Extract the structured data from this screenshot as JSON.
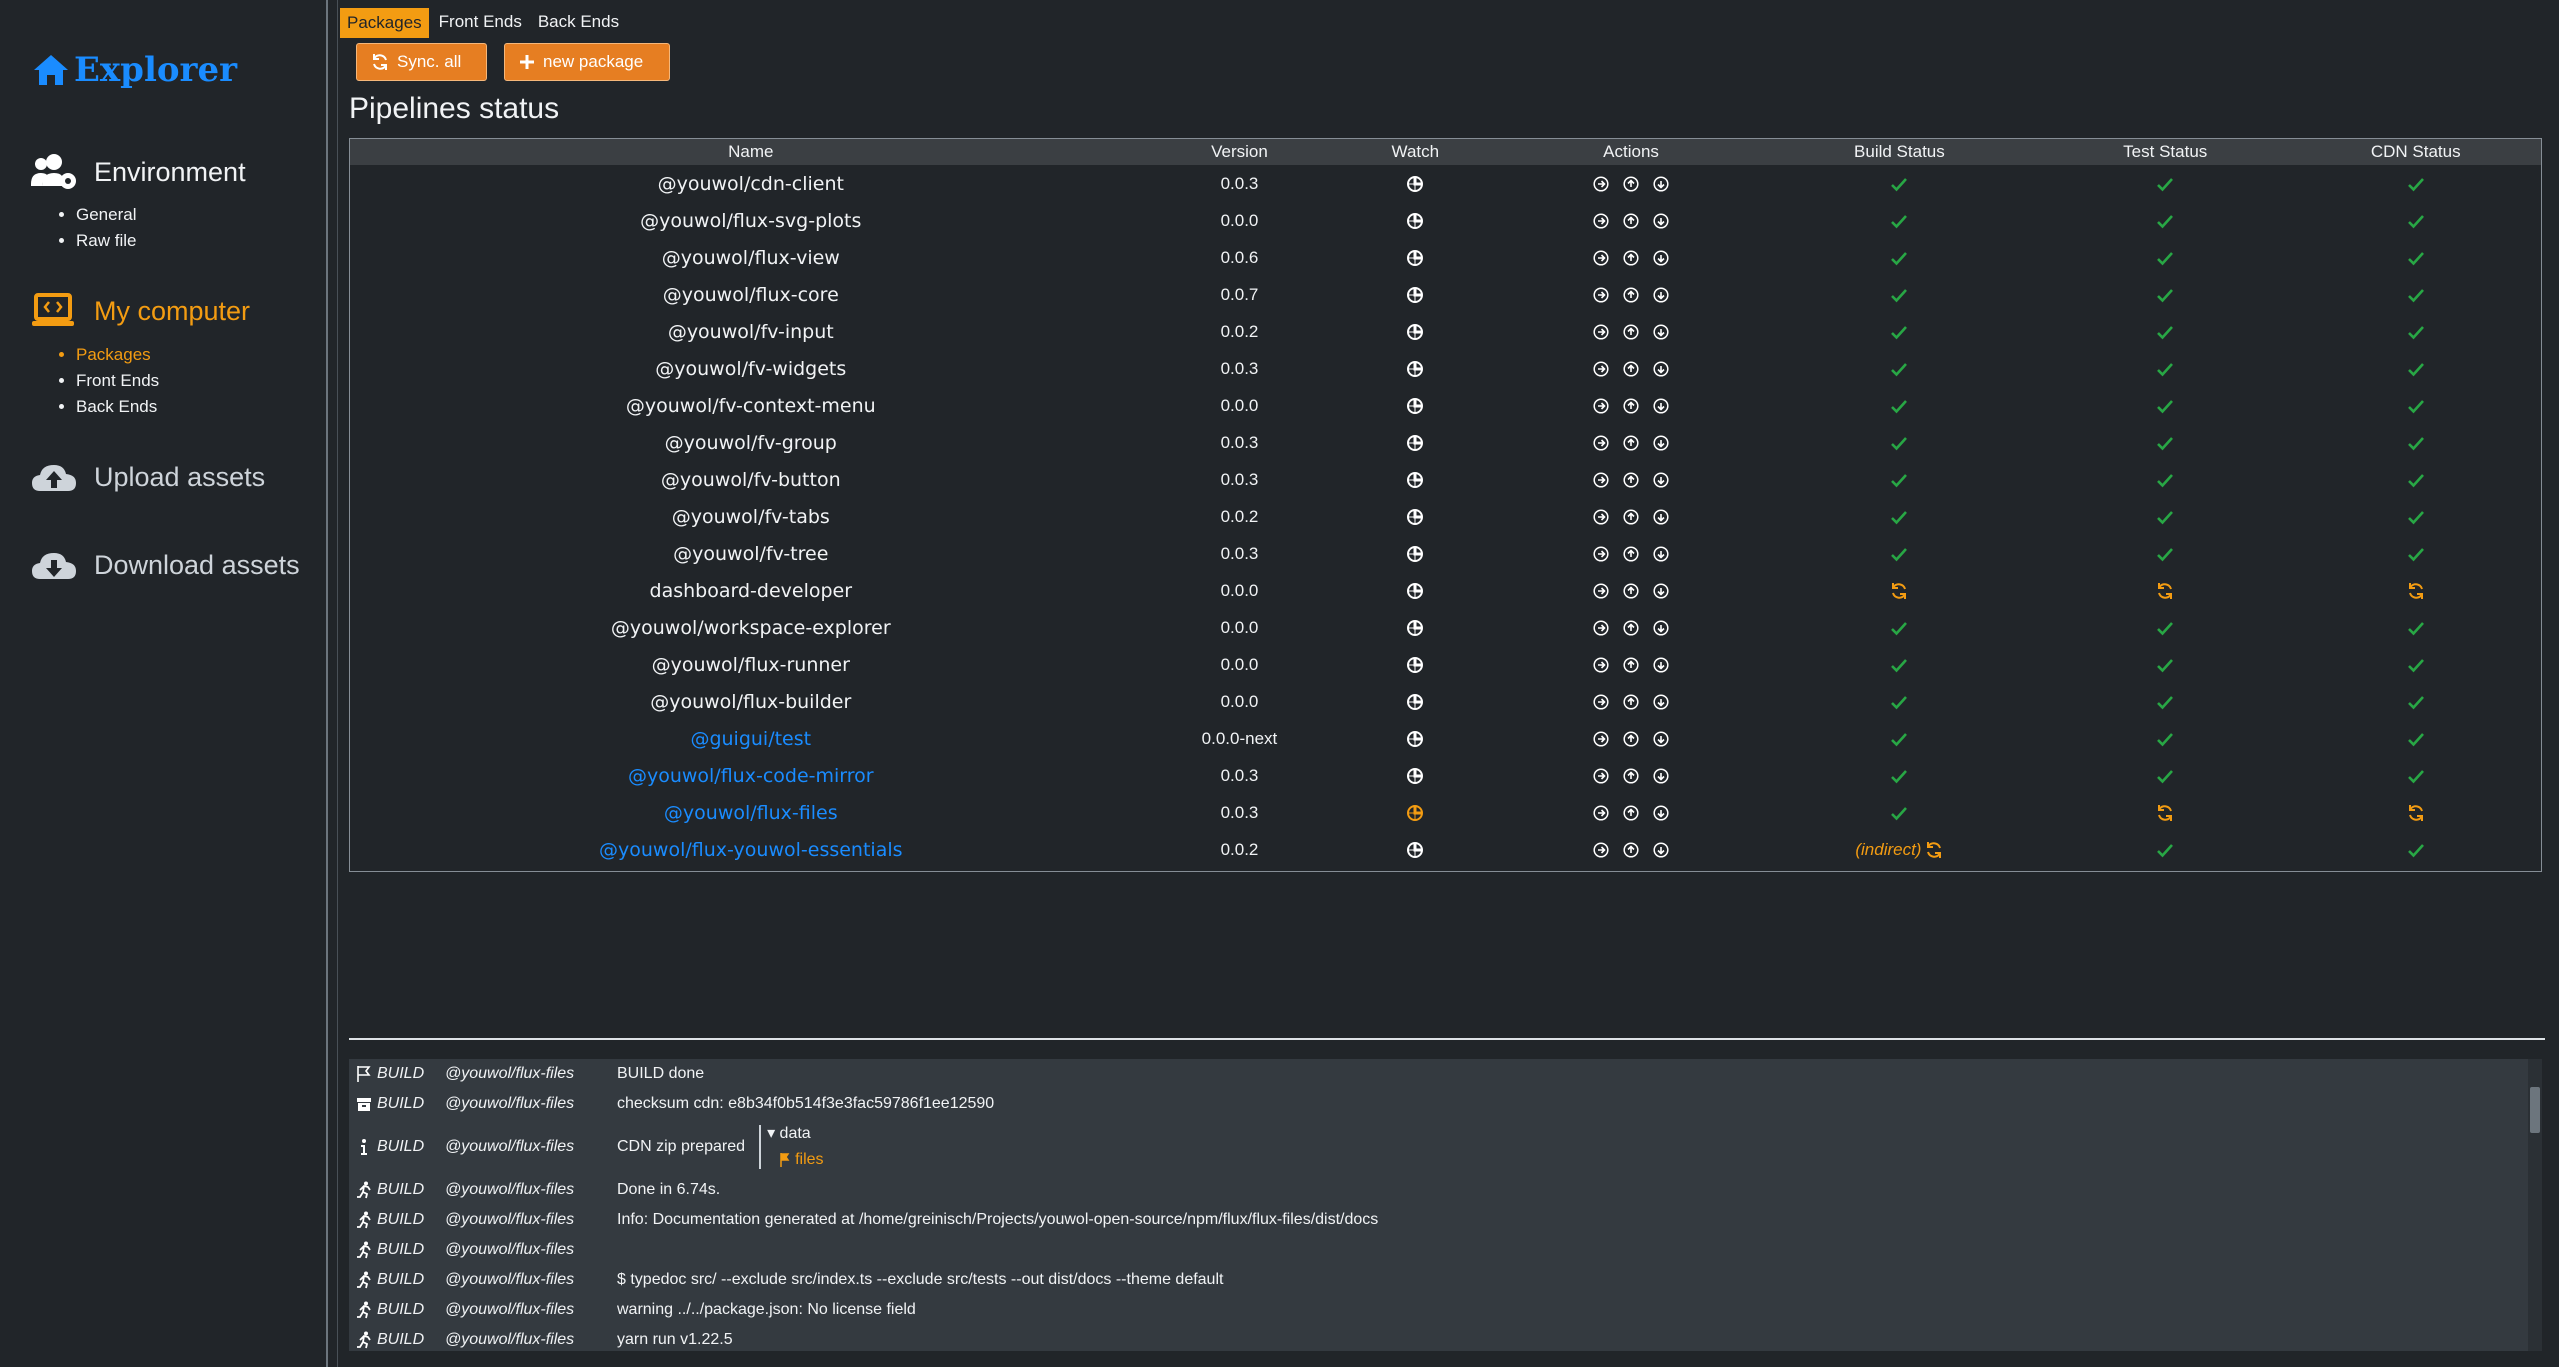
{
  "sidebar": {
    "brand": "Explorer",
    "sections": [
      {
        "title": "Environment",
        "icon": "users-cog-icon",
        "items": [
          "General",
          "Raw file"
        ]
      },
      {
        "title": "My computer",
        "icon": "laptop-code-icon",
        "items": [
          "Packages",
          "Front Ends",
          "Back Ends"
        ],
        "active": true,
        "active_item": "Packages"
      },
      {
        "title": "Upload assets",
        "icon": "cloud-upload-icon",
        "items": []
      },
      {
        "title": "Download assets",
        "icon": "cloud-download-icon",
        "items": []
      }
    ]
  },
  "tabs": [
    "Packages",
    "Front Ends",
    "Back Ends"
  ],
  "active_tab": "Packages",
  "buttons": {
    "sync": "Sync. all",
    "new_package": "new package"
  },
  "page_title": "Pipelines status",
  "table": {
    "headers": [
      "Name",
      "Version",
      "Watch",
      "Actions",
      "Build Status",
      "Test Status",
      "CDN Status"
    ],
    "rows": [
      {
        "name": "@youwol/cdn-client",
        "version": "0.0.3",
        "watch": "off",
        "build": "ok",
        "test": "ok",
        "cdn": "ok",
        "link": false
      },
      {
        "name": "@youwol/flux-svg-plots",
        "version": "0.0.0",
        "watch": "off",
        "build": "ok",
        "test": "ok",
        "cdn": "ok",
        "link": false
      },
      {
        "name": "@youwol/flux-view",
        "version": "0.0.6",
        "watch": "off",
        "build": "ok",
        "test": "ok",
        "cdn": "ok",
        "link": false
      },
      {
        "name": "@youwol/flux-core",
        "version": "0.0.7",
        "watch": "off",
        "build": "ok",
        "test": "ok",
        "cdn": "ok",
        "link": false
      },
      {
        "name": "@youwol/fv-input",
        "version": "0.0.2",
        "watch": "off",
        "build": "ok",
        "test": "ok",
        "cdn": "ok",
        "link": false
      },
      {
        "name": "@youwol/fv-widgets",
        "version": "0.0.3",
        "watch": "off",
        "build": "ok",
        "test": "ok",
        "cdn": "ok",
        "link": false
      },
      {
        "name": "@youwol/fv-context-menu",
        "version": "0.0.0",
        "watch": "off",
        "build": "ok",
        "test": "ok",
        "cdn": "ok",
        "link": false
      },
      {
        "name": "@youwol/fv-group",
        "version": "0.0.3",
        "watch": "off",
        "build": "ok",
        "test": "ok",
        "cdn": "ok",
        "link": false
      },
      {
        "name": "@youwol/fv-button",
        "version": "0.0.3",
        "watch": "off",
        "build": "ok",
        "test": "ok",
        "cdn": "ok",
        "link": false
      },
      {
        "name": "@youwol/fv-tabs",
        "version": "0.0.2",
        "watch": "off",
        "build": "ok",
        "test": "ok",
        "cdn": "ok",
        "link": false
      },
      {
        "name": "@youwol/fv-tree",
        "version": "0.0.3",
        "watch": "off",
        "build": "ok",
        "test": "ok",
        "cdn": "ok",
        "link": false
      },
      {
        "name": "dashboard-developer",
        "version": "0.0.0",
        "watch": "off",
        "build": "sync",
        "test": "sync",
        "cdn": "sync",
        "link": false
      },
      {
        "name": "@youwol/workspace-explorer",
        "version": "0.0.0",
        "watch": "off",
        "build": "ok",
        "test": "ok",
        "cdn": "ok",
        "link": false
      },
      {
        "name": "@youwol/flux-runner",
        "version": "0.0.0",
        "watch": "off",
        "build": "ok",
        "test": "ok",
        "cdn": "ok",
        "link": false
      },
      {
        "name": "@youwol/flux-builder",
        "version": "0.0.0",
        "watch": "off",
        "build": "ok",
        "test": "ok",
        "cdn": "ok",
        "link": false
      },
      {
        "name": "@guigui/test",
        "version": "0.0.0-next",
        "watch": "off",
        "build": "ok",
        "test": "ok",
        "cdn": "ok",
        "link": true
      },
      {
        "name": "@youwol/flux-code-mirror",
        "version": "0.0.3",
        "watch": "off",
        "build": "ok",
        "test": "ok",
        "cdn": "ok",
        "link": true
      },
      {
        "name": "@youwol/flux-files",
        "version": "0.0.3",
        "watch": "on",
        "build": "ok",
        "test": "sync",
        "cdn": "sync",
        "link": true
      },
      {
        "name": "@youwol/flux-youwol-essentials",
        "version": "0.0.2",
        "watch": "off",
        "build": "indirect",
        "test": "ok",
        "cdn": "ok",
        "link": true
      }
    ],
    "indirect_label": "(indirect)"
  },
  "log": {
    "rows": [
      {
        "icon": "flag-icon",
        "step": "BUILD",
        "pkg": "@youwol/flux-files",
        "msg": "BUILD done"
      },
      {
        "icon": "archive-icon",
        "step": "BUILD",
        "pkg": "@youwol/flux-files",
        "msg": "checksum cdn: e8b34f0b514f3e3fac59786f1ee12590"
      },
      {
        "icon": "info-icon",
        "step": "BUILD",
        "pkg": "@youwol/flux-files",
        "msg": "CDN zip prepared",
        "tree": [
          "data",
          "files"
        ]
      },
      {
        "icon": "running-icon",
        "step": "BUILD",
        "pkg": "@youwol/flux-files",
        "msg": "Done in 6.74s."
      },
      {
        "icon": "running-icon",
        "step": "BUILD",
        "pkg": "@youwol/flux-files",
        "msg": "Info: Documentation generated at /home/greinisch/Projects/youwol-open-source/npm/flux/flux-files/dist/docs"
      },
      {
        "icon": "running-icon",
        "step": "BUILD",
        "pkg": "@youwol/flux-files",
        "msg": ""
      },
      {
        "icon": "running-icon",
        "step": "BUILD",
        "pkg": "@youwol/flux-files",
        "msg": "$ typedoc src/ --exclude src/index.ts --exclude src/tests --out dist/docs --theme default"
      },
      {
        "icon": "running-icon",
        "step": "BUILD",
        "pkg": "@youwol/flux-files",
        "msg": "warning ../../package.json: No license field"
      },
      {
        "icon": "running-icon",
        "step": "BUILD",
        "pkg": "@youwol/flux-files",
        "msg": "yarn run v1.22.5"
      }
    ]
  },
  "colors": {
    "accent": "#f39c12",
    "button": "#e67e22",
    "ok": "#28a745",
    "link": "#1a8cff",
    "brand": "#1a8cff"
  }
}
